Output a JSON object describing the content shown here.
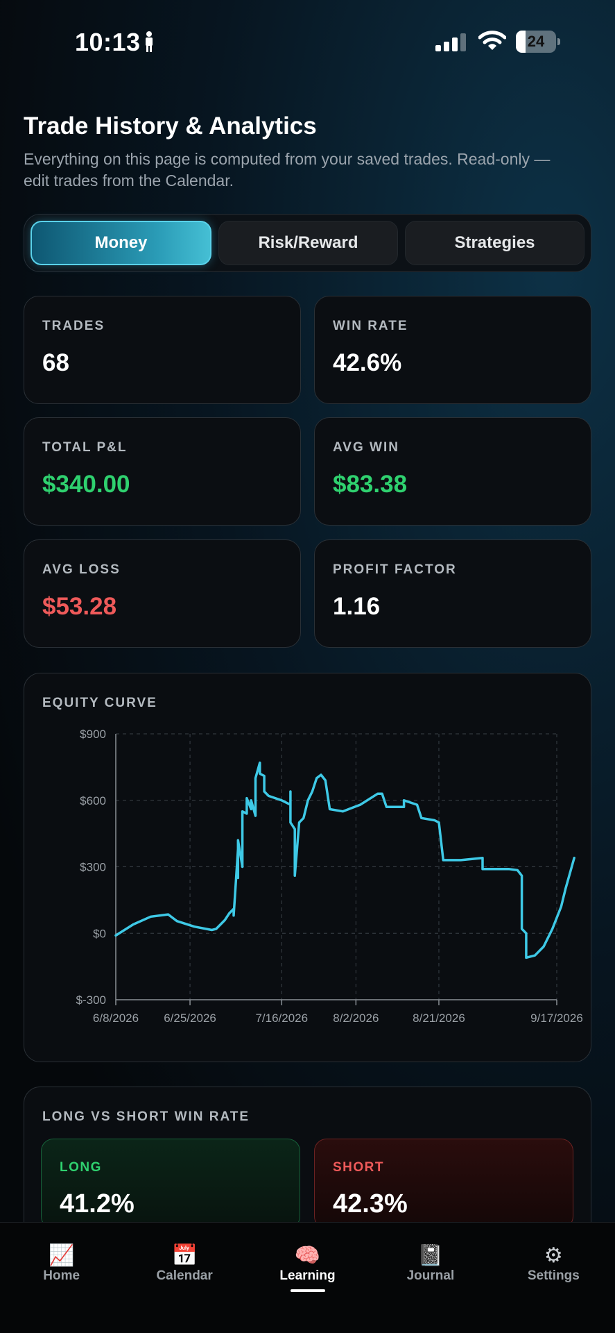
{
  "status_bar": {
    "time": "10:13",
    "battery": "24"
  },
  "header": {
    "title": "Trade History & Analytics",
    "subtitle": "Everything on this page is computed from your saved trades. Read-only — edit trades from the Calendar."
  },
  "segments": [
    {
      "label": "Money",
      "active": true
    },
    {
      "label": "Risk/Reward",
      "active": false
    },
    {
      "label": "Strategies",
      "active": false
    }
  ],
  "stats": [
    {
      "label": "TRADES",
      "value": "68",
      "tone": "neutral"
    },
    {
      "label": "WIN RATE",
      "value": "42.6%",
      "tone": "neutral"
    },
    {
      "label": "TOTAL P&L",
      "value": "$340.00",
      "tone": "positive"
    },
    {
      "label": "AVG WIN",
      "value": "$83.38",
      "tone": "positive"
    },
    {
      "label": "AVG LOSS",
      "value": "$53.28",
      "tone": "negative"
    },
    {
      "label": "PROFIT FACTOR",
      "value": "1.16",
      "tone": "neutral"
    }
  ],
  "colors": {
    "accent": "#3ec9e6",
    "positive": "#2fd16f",
    "negative": "#ef5a5a"
  },
  "equity_panel": {
    "title": "EQUITY CURVE"
  },
  "chart_data": {
    "type": "line",
    "title": "EQUITY CURVE",
    "xlabel": "",
    "ylabel": "",
    "x_ticks": [
      "6/8/2026",
      "6/25/2026",
      "7/16/2026",
      "8/2/2026",
      "8/21/2026",
      "9/17/2026"
    ],
    "y_ticks": [
      "$900",
      "$600",
      "$300",
      "$0",
      "$-300"
    ],
    "x_range": [
      "2026-06-08",
      "2026-09-17"
    ],
    "ylim": [
      -300,
      900
    ],
    "grid": true,
    "series": [
      {
        "color": "#3ec9e6",
        "points": [
          [
            "2026-06-08",
            -10
          ],
          [
            "2026-06-12",
            40
          ],
          [
            "2026-06-16",
            75
          ],
          [
            "2026-06-20",
            85
          ],
          [
            "2026-06-22",
            55
          ],
          [
            "2026-06-26",
            30
          ],
          [
            "2026-06-30",
            15
          ],
          [
            "2026-07-01",
            20
          ],
          [
            "2026-07-03",
            60
          ],
          [
            "2026-07-04",
            90
          ],
          [
            "2026-07-05",
            110
          ],
          [
            "2026-07-05",
            80
          ],
          [
            "2026-07-06",
            380
          ],
          [
            "2026-07-06",
            250
          ],
          [
            "2026-07-06",
            420
          ],
          [
            "2026-07-07",
            300
          ],
          [
            "2026-07-07",
            550
          ],
          [
            "2026-07-08",
            540
          ],
          [
            "2026-07-08",
            610
          ],
          [
            "2026-07-09",
            560
          ],
          [
            "2026-07-09",
            600
          ],
          [
            "2026-07-10",
            530
          ],
          [
            "2026-07-10",
            700
          ],
          [
            "2026-07-11",
            770
          ],
          [
            "2026-07-11",
            720
          ],
          [
            "2026-07-12",
            710
          ],
          [
            "2026-07-12",
            640
          ],
          [
            "2026-07-13",
            620
          ],
          [
            "2026-07-16",
            600
          ],
          [
            "2026-07-18",
            580
          ],
          [
            "2026-07-18",
            640
          ],
          [
            "2026-07-18",
            500
          ],
          [
            "2026-07-19",
            470
          ],
          [
            "2026-07-19",
            260
          ],
          [
            "2026-07-20",
            500
          ],
          [
            "2026-07-21",
            520
          ],
          [
            "2026-07-22",
            600
          ],
          [
            "2026-07-23",
            640
          ],
          [
            "2026-07-24",
            700
          ],
          [
            "2026-07-25",
            715
          ],
          [
            "2026-07-26",
            690
          ],
          [
            "2026-07-27",
            560
          ],
          [
            "2026-07-30",
            550
          ],
          [
            "2026-08-03",
            580
          ],
          [
            "2026-08-07",
            630
          ],
          [
            "2026-08-08",
            630
          ],
          [
            "2026-08-09",
            570
          ],
          [
            "2026-08-13",
            570
          ],
          [
            "2026-08-13",
            600
          ],
          [
            "2026-08-16",
            580
          ],
          [
            "2026-08-17",
            520
          ],
          [
            "2026-08-20",
            510
          ],
          [
            "2026-08-21",
            500
          ],
          [
            "2026-08-22",
            330
          ],
          [
            "2026-08-26",
            330
          ],
          [
            "2026-08-31",
            340
          ],
          [
            "2026-08-31",
            290
          ],
          [
            "2026-09-04",
            290
          ],
          [
            "2026-09-06",
            290
          ],
          [
            "2026-09-08",
            285
          ],
          [
            "2026-09-09",
            260
          ],
          [
            "2026-09-09",
            20
          ],
          [
            "2026-09-10",
            0
          ],
          [
            "2026-09-10",
            -110
          ],
          [
            "2026-09-12",
            -100
          ],
          [
            "2026-09-14",
            -60
          ],
          [
            "2026-09-16",
            20
          ],
          [
            "2026-09-18",
            120
          ],
          [
            "2026-09-19",
            200
          ],
          [
            "2026-09-21",
            340
          ]
        ]
      }
    ]
  },
  "long_short": {
    "title": "LONG VS SHORT WIN RATE",
    "long": {
      "label": "LONG",
      "value": "41.2%"
    },
    "short": {
      "label": "SHORT",
      "value": "42.3%"
    }
  },
  "tabbar": [
    {
      "label": "Home",
      "icon": "chart-up-icon",
      "glyph": "📈",
      "active": false
    },
    {
      "label": "Calendar",
      "icon": "calendar-icon",
      "glyph": "📅",
      "active": false
    },
    {
      "label": "Learning",
      "icon": "brain-icon",
      "glyph": "🧠",
      "active": true
    },
    {
      "label": "Journal",
      "icon": "notebook-icon",
      "glyph": "📓",
      "active": false
    },
    {
      "label": "Settings",
      "icon": "gear-icon",
      "glyph": "⚙",
      "active": false
    }
  ]
}
